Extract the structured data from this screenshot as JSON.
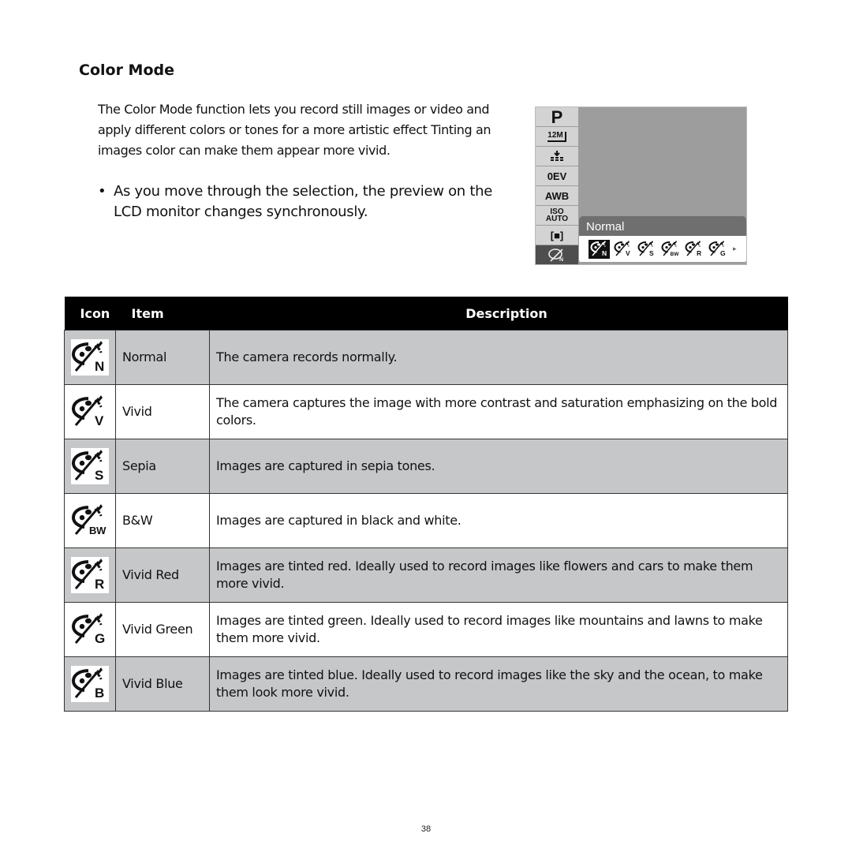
{
  "section": {
    "title": "Color Mode",
    "intro": "The Color Mode function lets you record still images or video and apply different colors or tones for a more artistic effect Tinting an images color can make them appear more vivid.",
    "bullet": "As you move through the selection, the preview on the LCD monitor changes synchronously.",
    "bullet_symbol": "•"
  },
  "lcd": {
    "side_items": [
      {
        "label": "P",
        "icon": "program-mode-icon"
      },
      {
        "label": "12M",
        "icon": "resolution-icon"
      },
      {
        "label": "",
        "icon": "quality-icon"
      },
      {
        "label": "0EV",
        "icon": "exposure-icon"
      },
      {
        "label": "AWB",
        "icon": "white-balance-icon"
      },
      {
        "label1": "ISO",
        "label2": "AUTO",
        "icon": "iso-icon"
      },
      {
        "label": "[■]",
        "icon": "metering-icon"
      },
      {
        "label": "",
        "icon": "color-mode-icon",
        "selected": true
      }
    ],
    "selected_label": "Normal",
    "option_letters": [
      "N",
      "V",
      "S",
      "BW",
      "R",
      "G"
    ],
    "selected_index": 0,
    "more_arrow": "▸"
  },
  "table": {
    "headers": {
      "icon": "Icon",
      "item": "Item",
      "description": "Description"
    },
    "rows": [
      {
        "letter": "N",
        "item": "Normal",
        "description": "The camera records normally."
      },
      {
        "letter": "V",
        "item": "Vivid",
        "description": "The camera captures the image with more contrast and saturation emphasizing on the bold colors."
      },
      {
        "letter": "S",
        "item": "Sepia",
        "description": "Images are captured in sepia tones."
      },
      {
        "letter": "BW",
        "item": "B&W",
        "description": "Images are captured in black and white."
      },
      {
        "letter": "R",
        "item": "Vivid Red",
        "description": "Images are tinted red. Ideally used to record images like flowers and cars to make them more vivid."
      },
      {
        "letter": "G",
        "item": "Vivid Green",
        "description": "Images are tinted green. Ideally used to record images like mountains and lawns to make them more vivid."
      },
      {
        "letter": "B",
        "item": "Vivid Blue",
        "description": "Images are tinted blue. Ideally used to record images like the sky and the ocean, to make them look more vivid."
      }
    ]
  },
  "page_number": "38"
}
